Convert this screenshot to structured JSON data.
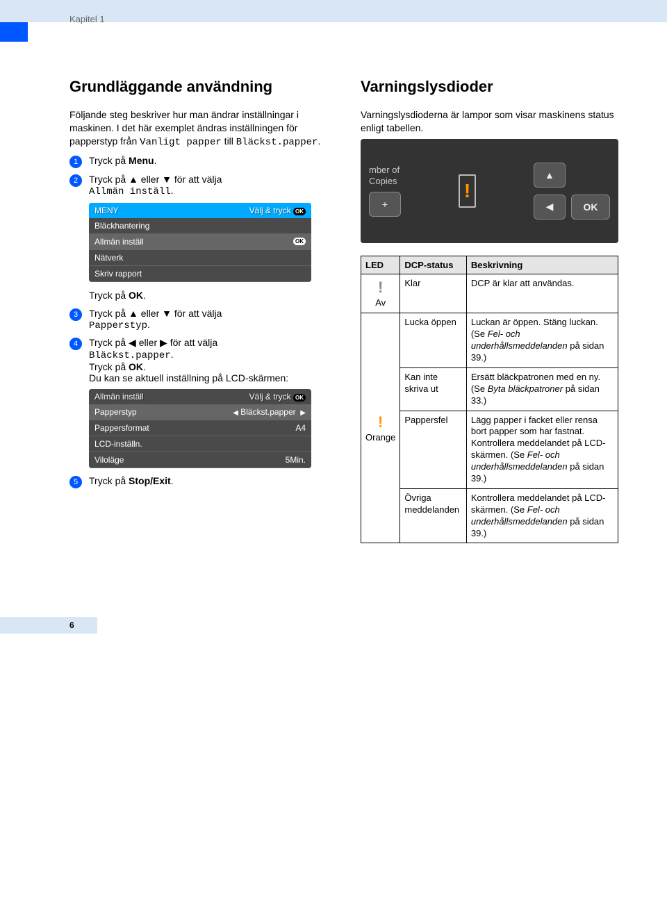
{
  "chapter": "Kapitel 1",
  "pageNumber": "6",
  "left": {
    "h1": "Grundläggande användning",
    "intro_a": "Följande steg beskriver hur man ändrar inställningar i maskinen. I det här exemplet ändras inställningen för papperstyp från ",
    "intro_mono1": "Vanligt papper",
    "intro_mid": " till ",
    "intro_mono2": "Bläckst.papper",
    "intro_end": ".",
    "step1_a": "Tryck på ",
    "step1_b": "Menu",
    "step1_c": ".",
    "step2_a": "Tryck på ▲ eller ▼ för att välja ",
    "step2_mono": "Allmän inställ",
    "step2_c": ".",
    "lcd1": {
      "title": "MENY",
      "hint": "Välj & tryck",
      "r1": "Bläckhantering",
      "r2": "Allmän inställ",
      "r3": "Nätverk",
      "r4": "Skriv rapport",
      "ok": "OK"
    },
    "pressOK_a": "Tryck på ",
    "pressOK_b": "OK",
    "pressOK_c": ".",
    "step3_a": "Tryck på ▲ eller ▼ för att välja ",
    "step3_mono": "Papperstyp",
    "step3_c": ".",
    "step4_a": "Tryck på ◀ eller ▶ för att välja ",
    "step4_mono": "Bläckst.papper",
    "step4_c": ".",
    "step4_d": "Tryck på ",
    "step4_e": "OK",
    "step4_f": ".",
    "step4_g": "Du kan se aktuell inställning på LCD-skärmen:",
    "lcd2": {
      "title": "Allmän inställ",
      "hint": "Välj & tryck",
      "ok": "OK",
      "r1a": "Papperstyp",
      "r1b": "Bläckst.papper",
      "r2a": "Pappersformat",
      "r2b": "A4",
      "r3a": "LCD-inställn.",
      "r4a": "Viloläge",
      "r4b": "5Min."
    },
    "step5_a": "Tryck på ",
    "step5_b": "Stop/Exit",
    "step5_c": "."
  },
  "right": {
    "h1": "Varningslysdioder",
    "intro": "Varningslysdioderna är lampor som visar maskinens status enligt tabellen.",
    "panel": {
      "copies": "mber of\nCopies",
      "plus": "+",
      "ok": "OK"
    },
    "table": {
      "th1": "LED",
      "th2": "DCP-status",
      "th3": "Beskrivning",
      "row1": {
        "ledLabel": "Av",
        "status": "Klar",
        "desc": "DCP är klar att användas."
      },
      "row2": {
        "ledLabel": "Orange",
        "status": "Lucka öppen",
        "desc_a": "Luckan är öppen. Stäng luckan. (Se ",
        "desc_i": "Fel- och underhållsmeddelanden",
        "desc_b": " på sidan 39.)"
      },
      "row3": {
        "status": "Kan inte skriva ut",
        "desc_a": "Ersätt bläckpatronen med en ny. (Se ",
        "desc_i": "Byta bläckpatroner",
        "desc_b": " på sidan 33.)"
      },
      "row4": {
        "status": "Pappersfel",
        "desc_a": "Lägg papper i facket eller rensa bort papper som har fastnat. Kontrollera meddelandet på LCD-skärmen. (Se ",
        "desc_i": "Fel- och underhållsmeddelanden",
        "desc_b": " på sidan 39.)"
      },
      "row5": {
        "status": "Övriga meddelanden",
        "desc_a": "Kontrollera meddelandet på LCD-skärmen. (Se ",
        "desc_i": "Fel- och underhållsmeddelanden",
        "desc_b": " på sidan 39.)"
      }
    }
  }
}
